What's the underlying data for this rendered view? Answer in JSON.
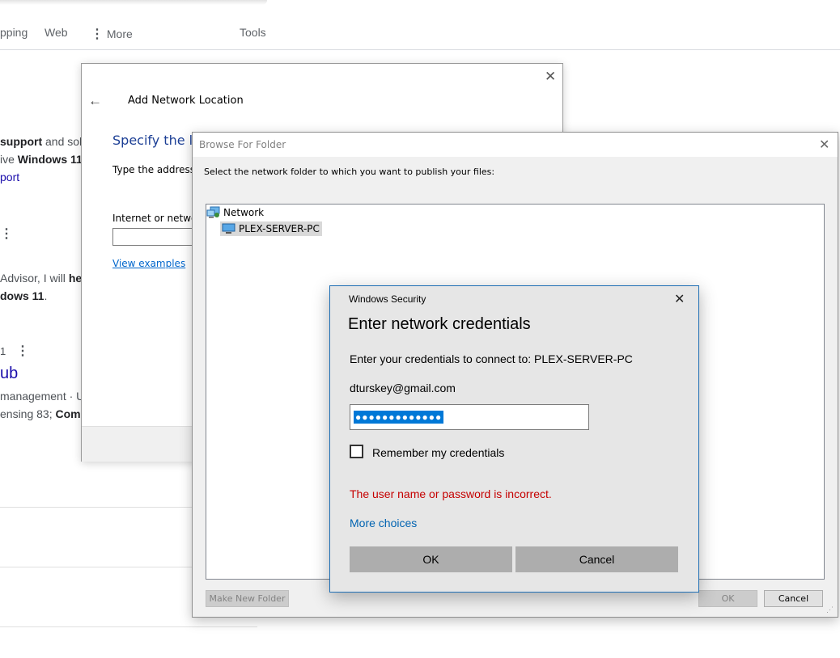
{
  "browser": {
    "tabs": {
      "shopping": "pping",
      "web": "Web",
      "more": "More",
      "tools": "Tools"
    },
    "results": [
      {
        "line1_bold": "support",
        "line1_rest": " and solu",
        "line2_pre": "ive ",
        "line2_bold": "Windows 11",
        "link": "port"
      },
      {
        "line1_pre": "Advisor, I will ",
        "line1_bold": "hel",
        "line2_bold": "dows 11",
        "line2_rest": "."
      },
      {
        "meta": "1",
        "title": "ub",
        "snippet1": "management · U",
        "snippet2_pre": "ensing 83; ",
        "snippet2_bold": "Com"
      }
    ]
  },
  "wizard": {
    "heading": "Add Network Location",
    "subheading": "Specify the loc",
    "type_address": "Type the address of",
    "field_label": "Internet or network",
    "field_value": "",
    "view_examples": "View examples",
    "icons": {
      "close": "close-icon",
      "back": "back-arrow-icon"
    }
  },
  "browse": {
    "title": "Browse For Folder",
    "instruction": "Select the network folder to which you want to publish your files:",
    "tree": {
      "network": "Network",
      "computer": "PLEX-SERVER-PC"
    },
    "buttons": {
      "new_folder": "Make New Folder",
      "ok": "OK",
      "cancel": "Cancel"
    }
  },
  "security": {
    "caption": "Windows Security",
    "title": "Enter network credentials",
    "connect_text": "Enter your credentials to connect to: PLEX-SERVER-PC",
    "username": "dturskey@gmail.com",
    "password_mask": "●●●●●●●●●●●●●",
    "remember": "Remember my credentials",
    "remember_checked": false,
    "error": "The user name or password is incorrect.",
    "more_choices": "More choices",
    "ok": "OK",
    "cancel": "Cancel",
    "colors": {
      "error": "#c50000",
      "link": "#0063b1",
      "selection": "#0078d7",
      "border": "#1f6fb5"
    }
  }
}
